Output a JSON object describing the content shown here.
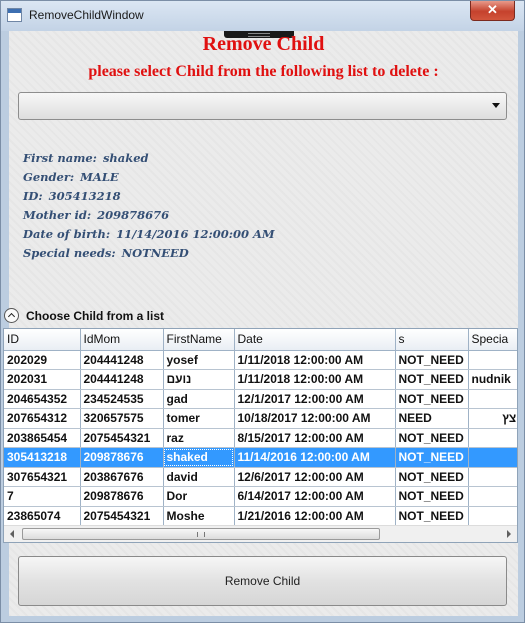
{
  "window": {
    "title": "RemoveChildWindow",
    "close_glyph": "✕"
  },
  "header": {
    "title": "Remove Child",
    "subtitle": "please select Child from the following list to delete :"
  },
  "combo": {
    "selected": ""
  },
  "details": [
    {
      "label": "First name:",
      "value": "shaked"
    },
    {
      "label": "Gender:",
      "value": "MALE"
    },
    {
      "label": "ID:",
      "value": "305413218"
    },
    {
      "label": "Mother id:",
      "value": "209878676"
    },
    {
      "label": "Date of birth:",
      "value": "11/14/2016 12:00:00 AM"
    },
    {
      "label": "Special needs:",
      "value": "NOTNEED"
    }
  ],
  "expander": {
    "label": "Choose Child from a list",
    "icon": "chevron-up-icon"
  },
  "table": {
    "columns": [
      "ID",
      "IdMom",
      "FirstName",
      "Date",
      "s",
      "Specia"
    ],
    "rows": [
      [
        "202029",
        "204441248",
        "yosef",
        "1/11/2018 12:00:00 AM",
        "NOT_NEED",
        ""
      ],
      [
        "202031",
        "204441248",
        "נועם",
        "1/11/2018 12:00:00 AM",
        "NOT_NEED",
        "nudnik"
      ],
      [
        "204654352",
        "234524535",
        "gad",
        "12/1/2017 12:00:00 AM",
        "NOT_NEED",
        ""
      ],
      [
        "207654312",
        "320657575",
        "tomer",
        "10/18/2017 12:00:00 AM",
        "NEED",
        "ם מוצץ"
      ],
      [
        "203865454",
        "2075454321",
        "raz",
        "8/15/2017 12:00:00 AM",
        "NOT_NEED",
        ""
      ],
      [
        "305413218",
        "209878676",
        "shaked",
        "11/14/2016 12:00:00 AM",
        "NOT_NEED",
        ""
      ],
      [
        "307654321",
        "203867676",
        "david",
        "12/6/2017 12:00:00 AM",
        "NOT_NEED",
        ""
      ],
      [
        "7",
        "209878676",
        "Dor",
        "6/14/2017 12:00:00 AM",
        "NOT_NEED",
        ""
      ],
      [
        "23865074",
        "2075454321",
        "Moshe",
        "1/21/2016 12:00:00 AM",
        "NOT_NEED",
        ""
      ]
    ],
    "selected_row": 5
  },
  "scrollbar_grip": "III",
  "remove_button": {
    "label": "Remove Child"
  },
  "colors": {
    "heading": "#e01010",
    "details": "#344f75",
    "selection": "#3399ff"
  }
}
